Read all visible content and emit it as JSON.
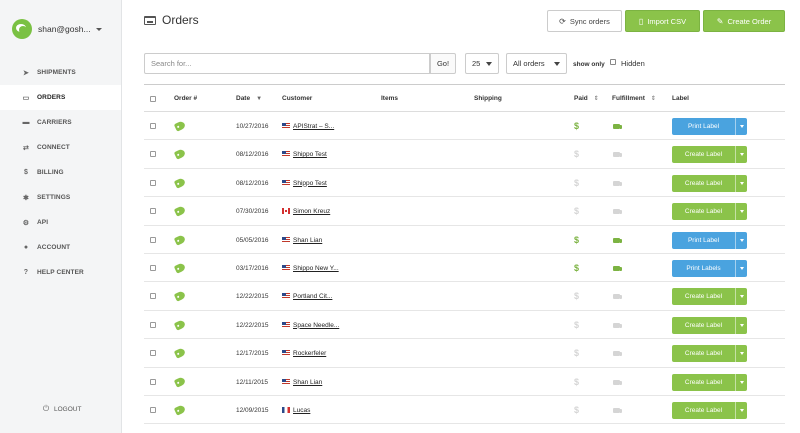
{
  "sidebar": {
    "account_name": "shan@gosh...",
    "items": [
      {
        "label": "SHIPMENTS",
        "icon": "paper-plane-icon",
        "glyph": "➤",
        "active": false
      },
      {
        "label": "ORDERS",
        "icon": "inbox-icon",
        "glyph": "▭",
        "active": true
      },
      {
        "label": "CARRIERS",
        "icon": "truck-icon",
        "glyph": "▬",
        "active": false
      },
      {
        "label": "CONNECT",
        "icon": "exchange-icon",
        "glyph": "⇄",
        "active": false
      },
      {
        "label": "BILLING",
        "icon": "dollar-icon",
        "glyph": "$",
        "active": false
      },
      {
        "label": "SETTINGS",
        "icon": "gear-icon",
        "glyph": "✱",
        "active": false
      },
      {
        "label": "API",
        "icon": "gears-icon",
        "glyph": "⚙",
        "active": false
      },
      {
        "label": "ACCOUNT",
        "icon": "user-icon",
        "glyph": "●",
        "active": false
      },
      {
        "label": "HELP CENTER",
        "icon": "question-icon",
        "glyph": "?",
        "active": false
      }
    ],
    "logout_label": "LOGOUT"
  },
  "header": {
    "title": "Orders",
    "sync_label": "Sync orders",
    "import_label": "Import CSV",
    "create_label": "Create Order"
  },
  "toolbar": {
    "search_placeholder": "Search for...",
    "go_label": "Go!",
    "page_size": "25",
    "filter_value": "All orders",
    "show_only_label": "show only",
    "hidden_label": "Hidden"
  },
  "table": {
    "headers": {
      "order": "Order #",
      "date": "Date",
      "customer": "Customer",
      "items": "Items",
      "shipping": "Shipping",
      "paid": "Paid",
      "fulfillment": "Fulfillment",
      "label": "Label"
    },
    "rows": [
      {
        "date": "10/27/2016",
        "flag": "us",
        "customer": "APIStrat – S...",
        "paid": true,
        "label": "Print Label",
        "style": "blue"
      },
      {
        "date": "08/12/2016",
        "flag": "us",
        "customer": "Shippo Test",
        "paid": false,
        "label": "Create Label",
        "style": "green"
      },
      {
        "date": "08/12/2016",
        "flag": "us",
        "customer": "Shippo Test",
        "paid": false,
        "label": "Create Label",
        "style": "green"
      },
      {
        "date": "07/30/2016",
        "flag": "ca",
        "customer": "Simon Kreuz",
        "paid": false,
        "label": "Create Label",
        "style": "green"
      },
      {
        "date": "05/05/2016",
        "flag": "us",
        "customer": "Shan Lian",
        "paid": true,
        "label": "Print Label",
        "style": "blue"
      },
      {
        "date": "03/17/2016",
        "flag": "us",
        "customer": "Shippo New Y...",
        "paid": true,
        "label": "Print Labels",
        "style": "blue"
      },
      {
        "date": "12/22/2015",
        "flag": "us",
        "customer": "Portland Cit...",
        "paid": false,
        "label": "Create Label",
        "style": "green"
      },
      {
        "date": "12/22/2015",
        "flag": "us",
        "customer": "Space Needle...",
        "paid": false,
        "label": "Create Label",
        "style": "green"
      },
      {
        "date": "12/17/2015",
        "flag": "us",
        "customer": "Rockerfeler",
        "paid": false,
        "label": "Create Label",
        "style": "green"
      },
      {
        "date": "12/11/2015",
        "flag": "us",
        "customer": "Shan Lian",
        "paid": false,
        "label": "Create Label",
        "style": "green"
      },
      {
        "date": "12/09/2015",
        "flag": "fr",
        "customer": "Lucas",
        "paid": false,
        "label": "Create Label",
        "style": "green"
      }
    ]
  },
  "colors": {
    "paid_active": "#7cb342",
    "paid_inactive": "#d5d5d5",
    "green": "#8bc34a",
    "blue": "#4aa3df"
  }
}
